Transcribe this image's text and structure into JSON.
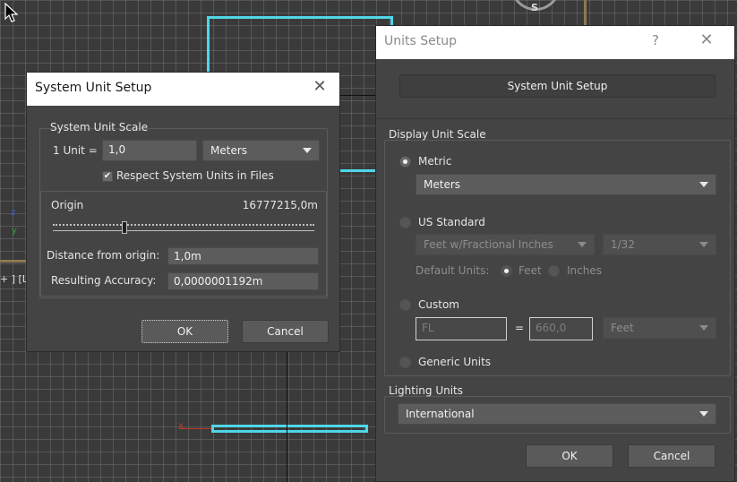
{
  "viewport": {
    "compass_label": "S",
    "label_left": "+ ] [L",
    "axis_z": "z",
    "axis_y": "y",
    "axis_x": "x"
  },
  "system_dialog": {
    "title": "System Unit Setup",
    "scale_group": {
      "label": "System Unit Scale",
      "unit_label": "1 Unit =",
      "unit_value": "1,0",
      "unit_type": "Meters",
      "respect_label": "Respect System Units in Files",
      "respect_checked": true
    },
    "origin_label": "Origin",
    "origin_value": "16777215,0m",
    "slider_fraction": 0.27,
    "distance_label": "Distance from origin:",
    "distance_value": "1,0m",
    "accuracy_label": "Resulting Accuracy:",
    "accuracy_value": "0,0000001192m",
    "ok_label": "OK",
    "cancel_label": "Cancel"
  },
  "units_dialog": {
    "title": "Units Setup",
    "help_glyph": "?",
    "system_button": "System Unit Setup",
    "display_group": {
      "label": "Display Unit Scale",
      "metric_label": "Metric",
      "metric_value": "Meters",
      "us_label": "US Standard",
      "us_value": "Feet w/Fractional Inches",
      "us_fraction": "1/32",
      "default_units_label": "Default Units:",
      "feet_label": "Feet",
      "inches_label": "Inches",
      "custom_label": "Custom",
      "custom_name": "FL",
      "equals": "=",
      "custom_value": "660,0",
      "custom_unit": "Feet",
      "generic_label": "Generic Units"
    },
    "lighting_group": {
      "label": "Lighting Units",
      "value": "International"
    },
    "ok_label": "OK",
    "cancel_label": "Cancel"
  },
  "colors": {
    "selection_outline": "#4fd6e8",
    "axis_red": "#c0392b",
    "axis_green": "#2ea043",
    "axis_blue": "#3a5fd0"
  }
}
